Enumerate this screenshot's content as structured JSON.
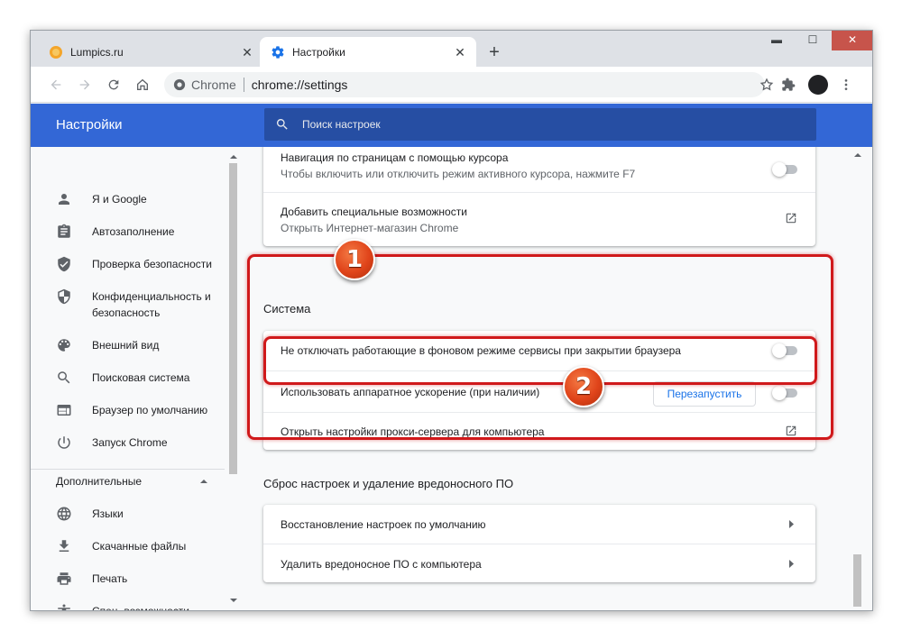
{
  "tabs": [
    {
      "label": "Lumpics.ru",
      "favicon": "lumpics-icon",
      "close": "✕"
    },
    {
      "label": "Настройки",
      "favicon": "gear-icon",
      "close": "✕"
    }
  ],
  "new_tab": "+",
  "window_controls": {
    "minimize": "▬",
    "maximize": "☐",
    "close": "✕"
  },
  "omnibox": {
    "site": "Chrome",
    "url": "chrome://settings"
  },
  "settings_header": {
    "title": "Настройки",
    "search_placeholder": "Поиск настроек"
  },
  "sidebar": {
    "items": [
      {
        "label": "Я и Google",
        "icon": "person-icon"
      },
      {
        "label": "Автозаполнение",
        "icon": "clipboard-icon"
      },
      {
        "label": "Проверка безопасности",
        "icon": "shield-check-icon"
      },
      {
        "label": "Конфиденциальность и безопасность",
        "icon": "shield-icon"
      },
      {
        "label": "Внешний вид",
        "icon": "palette-icon"
      },
      {
        "label": "Поисковая система",
        "icon": "search-icon"
      },
      {
        "label": "Браузер по умолчанию",
        "icon": "browser-icon"
      },
      {
        "label": "Запуск Chrome",
        "icon": "power-icon"
      }
    ],
    "advanced_label": "Дополнительные",
    "advanced_items": [
      {
        "label": "Языки",
        "icon": "globe-icon"
      },
      {
        "label": "Скачанные файлы",
        "icon": "download-icon"
      },
      {
        "label": "Печать",
        "icon": "printer-icon"
      },
      {
        "label": "Спец. возможности",
        "icon": "accessibility-icon"
      }
    ]
  },
  "accessibility_card": {
    "caret_row": {
      "title": "Навигация по страницам с помощью курсора",
      "subtitle": "Чтобы включить или отключить режим активного курсора, нажмите F7",
      "toggle_on": false
    },
    "extra_row": {
      "title": "Добавить специальные возможности",
      "subtitle": "Открыть Интернет-магазин Chrome"
    }
  },
  "system_section": {
    "title": "Система",
    "rows": [
      {
        "label": "Не отключать работающие в фоновом режиме сервисы при закрытии браузера",
        "toggle_on": false
      },
      {
        "label": "Использовать аппаратное ускорение (при наличии)",
        "button": "Перезапустить",
        "toggle_on": false
      },
      {
        "label": "Открыть настройки прокси-сервера для компьютера"
      }
    ]
  },
  "reset_section": {
    "title": "Сброс настроек и удаление вредоносного ПО",
    "rows": [
      {
        "label": "Восстановление настроек по умолчанию"
      },
      {
        "label": "Удалить вредоносное ПО с компьютера"
      }
    ]
  },
  "annotations": {
    "badge1": "1",
    "badge2": "2",
    "color": "#d0191b"
  },
  "colors": {
    "header_blue": "#3367d6",
    "search_blue": "#264ea3",
    "link_blue": "#1a73e8"
  }
}
